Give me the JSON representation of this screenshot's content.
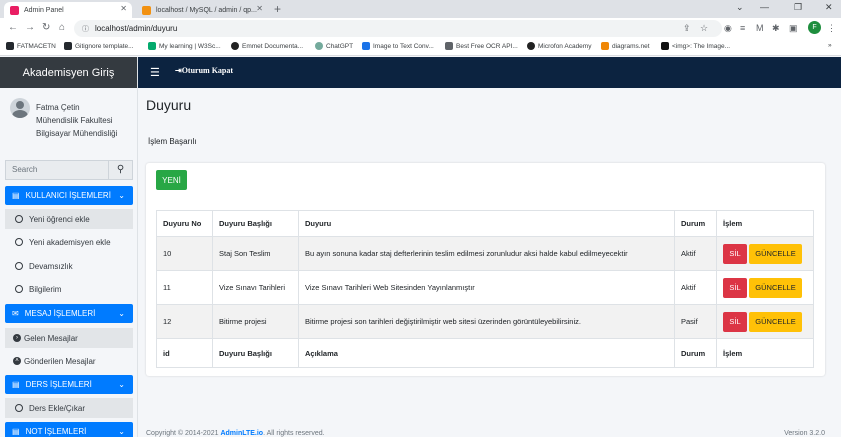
{
  "browser": {
    "tabs": [
      {
        "label": "Admin Panel",
        "fav_color": "#e91e63"
      },
      {
        "label": "localhost / MySQL / admin / qp...",
        "fav_color": "#f29111"
      }
    ],
    "new_tab": "+",
    "window_controls": [
      "⌄",
      "—",
      "❐",
      "✕"
    ],
    "url": "localhost/admin/duyuru",
    "profile_initial": "F",
    "bookmarks": [
      {
        "label": "FATMACETN",
        "color": "#24292e"
      },
      {
        "label": "Gitignore template...",
        "color": "#24292e"
      },
      {
        "label": "My learning | W3Sc...",
        "color": "#04aa6d"
      },
      {
        "label": "Emmet Documenta...",
        "color": "#222222"
      },
      {
        "label": "ChatGPT",
        "color": "#74aa9c"
      },
      {
        "label": "Image to Text Conv...",
        "color": "#1a73e8"
      },
      {
        "label": "Best Free OCR API...",
        "color": "#5f6368"
      },
      {
        "label": "Microfon Academy",
        "color": "#222222"
      },
      {
        "label": "diagrams.net",
        "color": "#f08705"
      },
      {
        "label": "<img>: The Image...",
        "color": "#111111"
      }
    ]
  },
  "sidebar": {
    "brand": "Akademisyen Giriş",
    "user": {
      "name": "Fatma  Çetin",
      "faculty": "Mühendislik Fakultesi",
      "department": "Bilgisayar Mühendisliği"
    },
    "search_placeholder": "Search",
    "sections": [
      {
        "title": "KULLANICI İŞLEMLERİ",
        "items": [
          "Yeni öğrenci ekle",
          "Yeni akademisyen ekle",
          "Devamsızlık",
          "Bilgilerim"
        ]
      },
      {
        "title": "MESAJ İŞLEMLERİ",
        "items": [
          "Gelen Mesajlar",
          "Gönderilen Mesajlar"
        ]
      },
      {
        "title": "DERS İŞLEMLERİ",
        "items": [
          "Ders Ekle/Çıkar"
        ]
      },
      {
        "title": "NOT İŞLEMLERİ",
        "items": []
      }
    ]
  },
  "topnav": {
    "logout": "Oturum Kapat"
  },
  "main": {
    "title": "Duyuru",
    "alert": "İşlem Başarılı",
    "new_button": "YENİ",
    "table": {
      "headers": [
        "Duyuru No",
        "Duyuru Başlığı",
        "Duyuru",
        "Durum",
        "İşlem"
      ],
      "rows": [
        {
          "no": "10",
          "title": "Staj Son Teslim",
          "text": "Bu ayın sonuna kadar staj defterlerinin teslim edilmesi zorunludur aksi halde kabul edilmeyecektir",
          "status": "Aktif"
        },
        {
          "no": "11",
          "title": "Vize Sınavı Tarihleri",
          "text": "Vize Sınavı Tarihleri Web Sitesinden Yayınlanmıştır",
          "status": "Aktif"
        },
        {
          "no": "12",
          "title": "Bitirme projesi",
          "text": "Bitirme projesi son tarihleri değiştirilmiştir web sitesi üzerinden görüntüleyebilirsiniz.",
          "status": "Pasif"
        }
      ],
      "footer": [
        "id",
        "Duyuru Başlığı",
        "Açıklama",
        "Durum",
        "İşlem"
      ],
      "delete_label": "SİL",
      "update_label": "GÜNCELLE"
    }
  },
  "footer": {
    "copyright": "Copyright © 2014-2021 ",
    "brand": "AdminLTE.io",
    "rights": ". All rights reserved.",
    "version": "Version 3.2.0"
  },
  "colors": {
    "primary": "#007bff",
    "success": "#28a745",
    "danger": "#dc3545",
    "warning": "#ffc107",
    "navbar": "#0c2340",
    "brand_bg": "#343a40"
  }
}
